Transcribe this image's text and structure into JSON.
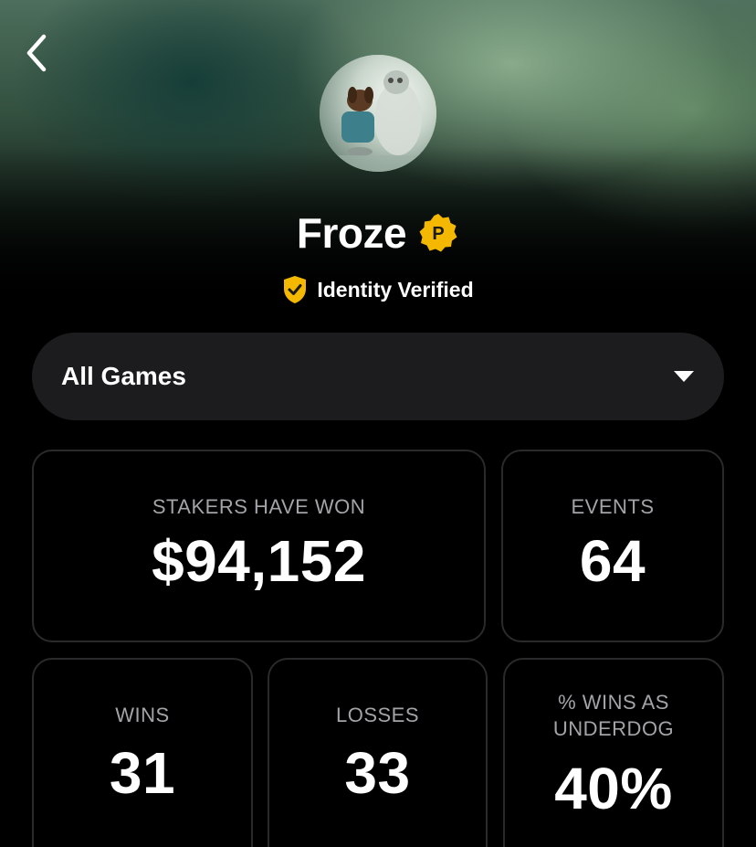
{
  "profile": {
    "name": "Froze",
    "verified_label": "Identity Verified",
    "badge_letter": "P"
  },
  "filter": {
    "selected": "All Games"
  },
  "stats": {
    "stakers_won": {
      "label": "STAKERS HAVE WON",
      "value": "$94,152"
    },
    "events": {
      "label": "EVENTS",
      "value": "64"
    },
    "wins": {
      "label": "WINS",
      "value": "31"
    },
    "losses": {
      "label": "LOSSES",
      "value": "33"
    },
    "underdog": {
      "label": "% WINS AS UNDERDOG",
      "value": "40%"
    }
  },
  "icons": {
    "back": "chevron-left-icon",
    "badge": "pro-badge-icon",
    "verified": "shield-check-icon",
    "dropdown": "caret-down-icon"
  },
  "colors": {
    "accent": "#f5b800",
    "background": "#000000",
    "card_border": "#2a2a2c",
    "select_bg": "#1c1c1e",
    "label_gray": "#a3a3a8"
  }
}
